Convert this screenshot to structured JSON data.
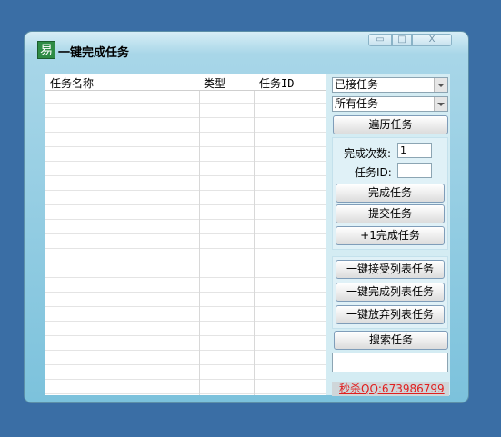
{
  "window": {
    "title": "一键完成任务",
    "icon_glyph": "易",
    "controls": {
      "minimize_glyph": "▭",
      "maximize_glyph": "□",
      "close_glyph": "X"
    }
  },
  "list": {
    "columns": [
      "任务名称",
      "类型",
      "任务ID"
    ],
    "rows": []
  },
  "filters": {
    "status_selected": "已接任务",
    "scope_selected": "所有任务"
  },
  "buttons": {
    "traverse": "遍历任务",
    "complete": "完成任务",
    "submit": "提交任务",
    "plus_one_complete": "+1完成任务",
    "accept_all": "一键接受列表任务",
    "complete_all": "一键完成列表任务",
    "abandon_all": "一键放弃列表任务",
    "search": "搜索任务"
  },
  "form": {
    "count_label": "完成次数:",
    "count_value": "1",
    "task_id_label": "任务ID:",
    "task_id_value": ""
  },
  "search": {
    "value": ""
  },
  "contact": {
    "text": "秒杀QQ:673986799"
  },
  "colors": {
    "desktop": "#3a6ea5",
    "window_frame": "#7cc2dc",
    "contact_text": "#e02020"
  }
}
